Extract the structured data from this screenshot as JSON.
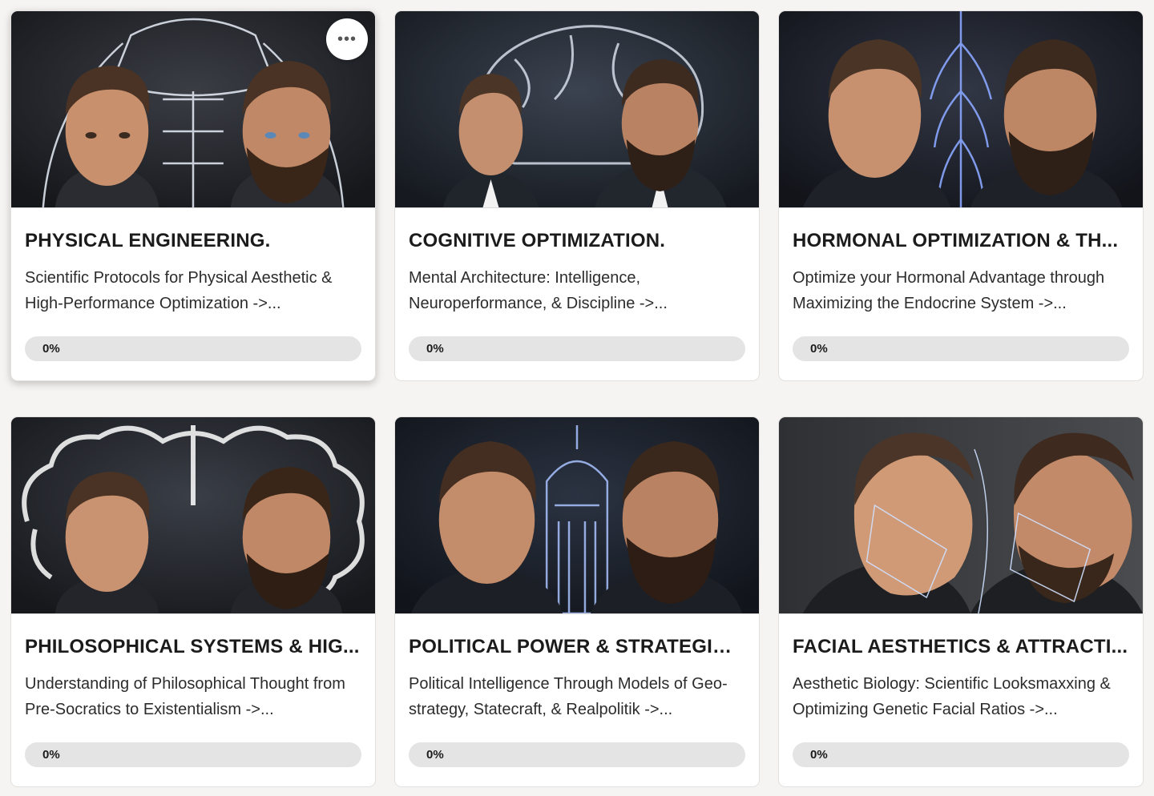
{
  "courses": [
    {
      "title": "PHYSICAL ENGINEERING.",
      "description": "Scientific Protocols for Physical Aesthetic & High-Performance Optimization ->...",
      "progress_label": "0%",
      "progress": 0,
      "image_theme": "muscle-outline",
      "hovered": true,
      "more_icon": "more-horizontal-icon"
    },
    {
      "title": "COGNITIVE OPTIMIZATION.",
      "description": "Mental Architecture: Intelligence, Neuroperformance, & Discipline ->...",
      "progress_label": "0%",
      "progress": 0,
      "image_theme": "brain-outline"
    },
    {
      "title": "HORMONAL OPTIMIZATION & TH...",
      "description": "Optimize your Hormonal Advantage through Maximizing the Endocrine System ->...",
      "progress_label": "0%",
      "progress": 0,
      "image_theme": "nerve-glow"
    },
    {
      "title": "PHILOSOPHICAL SYSTEMS & HIG...",
      "description": "Understanding of Philosophical Thought from Pre-Socratics to Existentialism ->...",
      "progress_label": "0%",
      "progress": 0,
      "image_theme": "brain-outline"
    },
    {
      "title": "POLITICAL POWER & STRATEGIC ...",
      "description": "Political Intelligence Through Models of Geo-strategy, Statecraft, & Realpolitik ->...",
      "progress_label": "0%",
      "progress": 0,
      "image_theme": "capitol-dome"
    },
    {
      "title": "FACIAL AESTHETICS & ATTRACTI...",
      "description": "Aesthetic Biology: Scientific Looksmaxxing & Optimizing Genetic Facial Ratios ->...",
      "progress_label": "0%",
      "progress": 0,
      "image_theme": "face-geometry"
    }
  ],
  "colors": {
    "page_bg": "#f6f4f2",
    "card_bg": "#ffffff",
    "progress_track": "#e4e4e4",
    "title_text": "#1b1b1b"
  }
}
